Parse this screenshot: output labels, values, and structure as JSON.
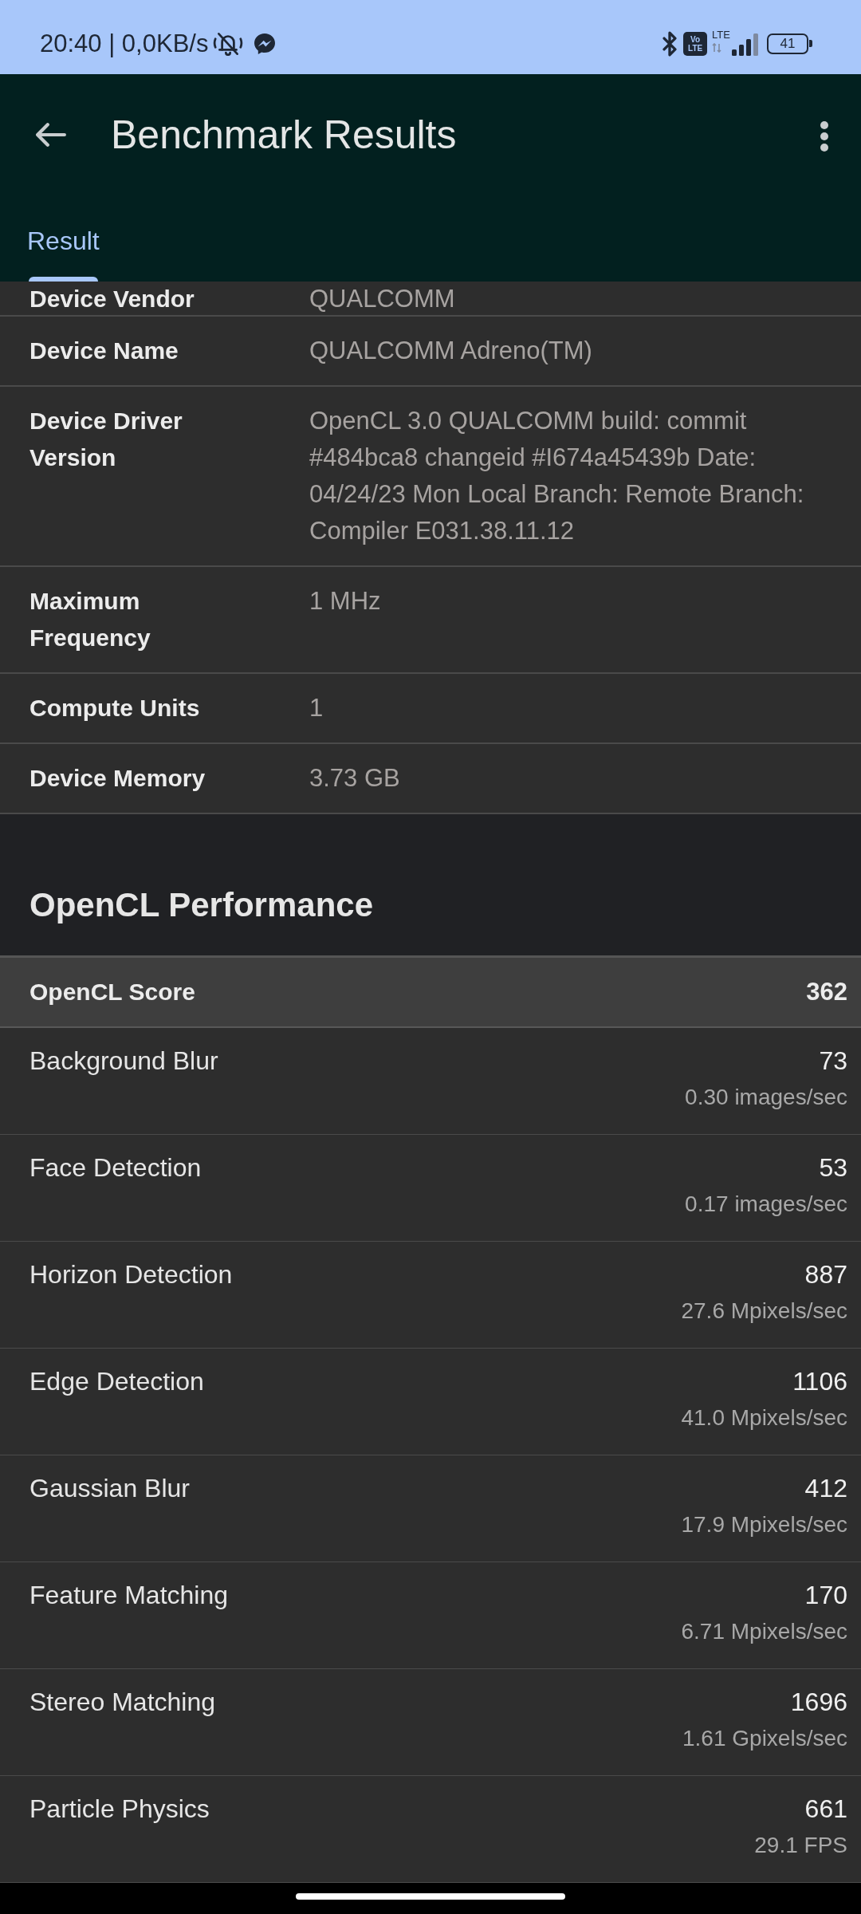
{
  "status_bar": {
    "text": "20:40 | 0,0KB/s",
    "volte_badge": [
      "Vo",
      "LTE"
    ],
    "network_label": "LTE",
    "battery": "41"
  },
  "app_bar": {
    "title": "Benchmark Results"
  },
  "tabs": [
    {
      "label": "Result",
      "selected": true
    }
  ],
  "device_info": {
    "partial_row": {
      "label": "Device Vendor",
      "value": "QUALCOMM"
    },
    "rows": [
      {
        "label": "Device Name",
        "value": "QUALCOMM Adreno(TM)"
      },
      {
        "label": "Device Driver Version",
        "value": "OpenCL 3.0 QUALCOMM build: commit #484bca8 changeid #I674a45439b Date: 04/24/23 Mon Local Branch: Remote Branch: Compiler E031.38.11.12"
      },
      {
        "label": "Maximum Frequency",
        "value": "1 MHz"
      },
      {
        "label": "Compute Units",
        "value": "1"
      },
      {
        "label": "Device Memory",
        "value": "3.73 GB"
      }
    ]
  },
  "performance": {
    "title": "OpenCL Performance",
    "total": {
      "label": "OpenCL Score",
      "score": "362"
    },
    "results": [
      {
        "name": "Background Blur",
        "score": "73",
        "rate": "0.30 images/sec"
      },
      {
        "name": "Face Detection",
        "score": "53",
        "rate": "0.17 images/sec"
      },
      {
        "name": "Horizon Detection",
        "score": "887",
        "rate": "27.6 Mpixels/sec"
      },
      {
        "name": "Edge Detection",
        "score": "1106",
        "rate": "41.0 Mpixels/sec"
      },
      {
        "name": "Gaussian Blur",
        "score": "412",
        "rate": "17.9 Mpixels/sec"
      },
      {
        "name": "Feature Matching",
        "score": "170",
        "rate": "6.71 Mpixels/sec"
      },
      {
        "name": "Stereo Matching",
        "score": "1696",
        "rate": "1.61 Gpixels/sec"
      },
      {
        "name": "Particle Physics",
        "score": "661",
        "rate": "29.1 FPS"
      }
    ]
  }
}
